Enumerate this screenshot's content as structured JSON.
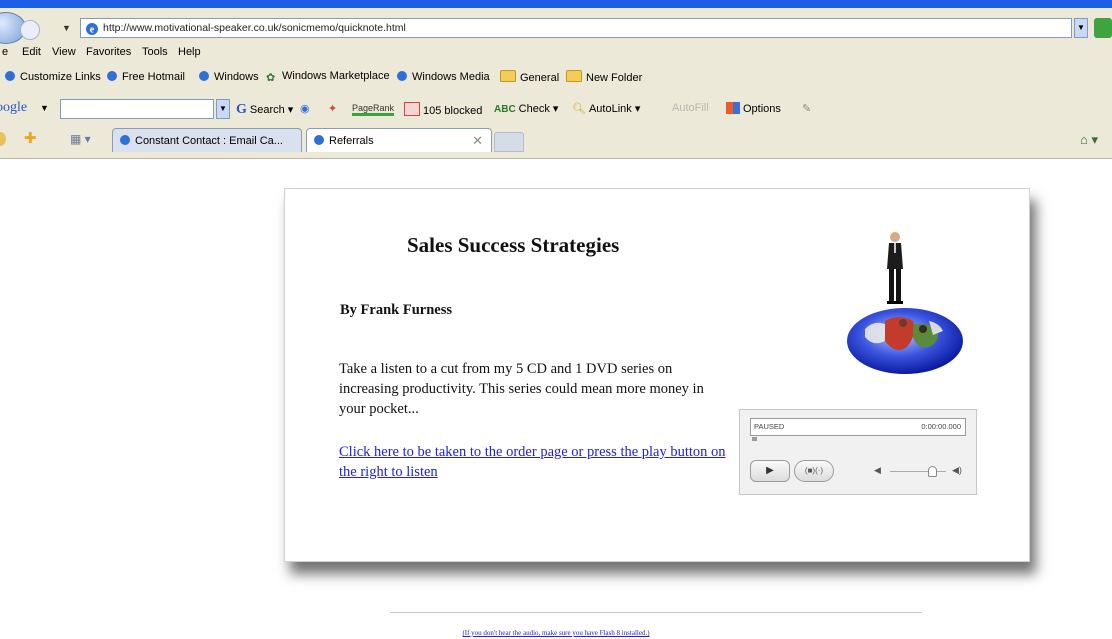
{
  "browser": {
    "address_url": "http://www.motivational-speaker.co.uk/sonicmemo/quicknote.html",
    "menu": [
      "e",
      "Edit",
      "View",
      "Favorites",
      "Tools",
      "Help"
    ],
    "links": [
      {
        "label": "Customize Links",
        "icon": "ie-icon"
      },
      {
        "label": "Free Hotmail",
        "icon": "ie-icon"
      },
      {
        "label": "Windows",
        "icon": "ie-icon"
      },
      {
        "label": "Windows Marketplace",
        "icon": "windows-marketplace-icon"
      },
      {
        "label": "Windows Media",
        "icon": "ie-icon"
      },
      {
        "label": "General",
        "icon": "folder-icon"
      },
      {
        "label": "New Folder",
        "icon": "folder-icon"
      }
    ],
    "google_toolbar": {
      "logo": "oogle",
      "search_label": "Search",
      "pagerank_label": "PageRank",
      "blocked_label": "105 blocked",
      "check_label": "Check",
      "autolink_label": "AutoLink",
      "autofill_label": "AutoFill",
      "options_label": "Options"
    },
    "tabs": [
      {
        "label": "Constant Contact : Email Ca...",
        "active": false
      },
      {
        "label": "Referrals",
        "active": true
      }
    ],
    "colors": {
      "titlebar": "#1d5ee6",
      "chrome": "#ece9d8"
    }
  },
  "page": {
    "title": "Sales Success Strategies",
    "byline": "By Frank Furness",
    "body": "Take a listen to a cut from my 5 CD and 1 DVD series on increasing productivity. This series could mean more money in your pocket...",
    "order_link": "Click here to be taken to the order page or press the play button on the right to listen",
    "player": {
      "status": "PAUSED",
      "time": "0:00:00.000",
      "volume_fraction": 0.75
    },
    "footnote": "(If you don't hear the audio, make sure you have Flash 8 installed.)"
  }
}
